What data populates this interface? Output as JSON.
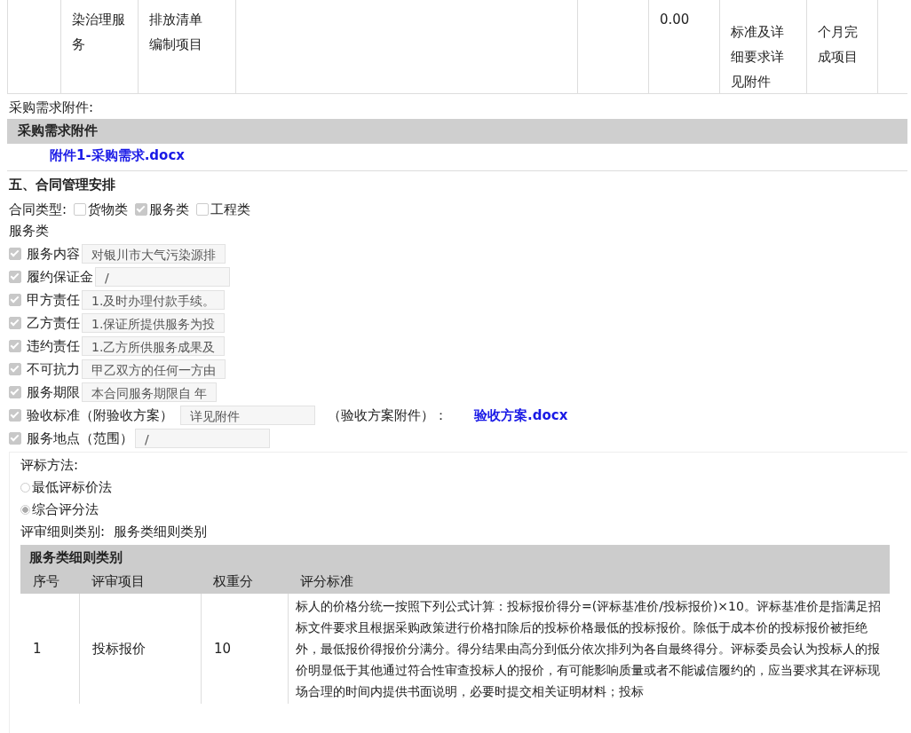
{
  "top_table": {
    "row": {
      "cells": [
        {},
        {
          "lines": [
            "染治理服",
            "务"
          ]
        },
        {
          "lines": [
            "排放清单",
            "编制项目"
          ]
        },
        {},
        {},
        {
          "lines": [
            "0.00"
          ]
        },
        {
          "lines": [
            "标准及详",
            "细要求详",
            "见附件"
          ]
        },
        {
          "lines": [
            "个月完",
            "成项目"
          ]
        },
        {}
      ]
    }
  },
  "attachments": {
    "label": "采购需求附件:",
    "header": "采购需求附件",
    "files": [
      "附件1-采购需求.docx"
    ]
  },
  "contract": {
    "title": "五、合同管理安排",
    "type_label": "合同类型:",
    "types": [
      {
        "label": "货物类",
        "checked": false
      },
      {
        "label": "服务类",
        "checked": true
      },
      {
        "label": "工程类",
        "checked": false
      }
    ],
    "category": "服务类",
    "fields": [
      {
        "label": "服务内容",
        "checked": true,
        "value": "对银川市大气污染源排"
      },
      {
        "label": "履约保证金",
        "checked": true,
        "value": "/"
      },
      {
        "label": "甲方责任",
        "checked": true,
        "value": "1.及时办理付款手续。"
      },
      {
        "label": "乙方责任",
        "checked": true,
        "value": "1.保证所提供服务为投"
      },
      {
        "label": "违约责任",
        "checked": true,
        "value": "1.乙方所供服务成果及"
      },
      {
        "label": "不可抗力",
        "checked": true,
        "value": "甲乙双方的任何一方由"
      },
      {
        "label": "服务期限",
        "checked": true,
        "value": "本合同服务期限自  年"
      },
      {
        "label": "验收标准（附验收方案）",
        "checked": true,
        "value": "详见附件",
        "extra_label": "（验收方案附件）：",
        "link": "验收方案.docx"
      },
      {
        "label": "服务地点（范围）",
        "checked": true,
        "value": "/"
      }
    ]
  },
  "evaluation": {
    "method_label": "评标方法:",
    "methods": [
      {
        "label": "最低评标价法",
        "selected": false
      },
      {
        "label": "综合评分法",
        "selected": true
      }
    ],
    "detail_label": "评审细则类别:",
    "detail_value": "服务类细则类别",
    "table": {
      "title": "服务类细则类别",
      "columns": [
        "序号",
        "评审项目",
        "权重分",
        "评分标准"
      ],
      "rows": [
        {
          "cells": [
            "1",
            "投标报价",
            "10",
            "标人的价格分统一按照下列公式计算：投标报价得分=(评标基准价/投标报价)×10。评标基准价是指满足招标文件要求且根据采购政策进行价格扣除后的投标价格最低的投标报价。除低于成本价的投标报价被拒绝外，最低报价得报价分满分。得分结果由高分到低分依次排列为各自最终得分。评标委员会认为投标人的报价明显低于其他通过符合性审查投标人的报价，有可能影响质量或者不能诚信履约的，应当要求其在评标现场合理的时间内提供书面说明，必要时提交相关证明材料；投标"
          ]
        }
      ]
    }
  }
}
